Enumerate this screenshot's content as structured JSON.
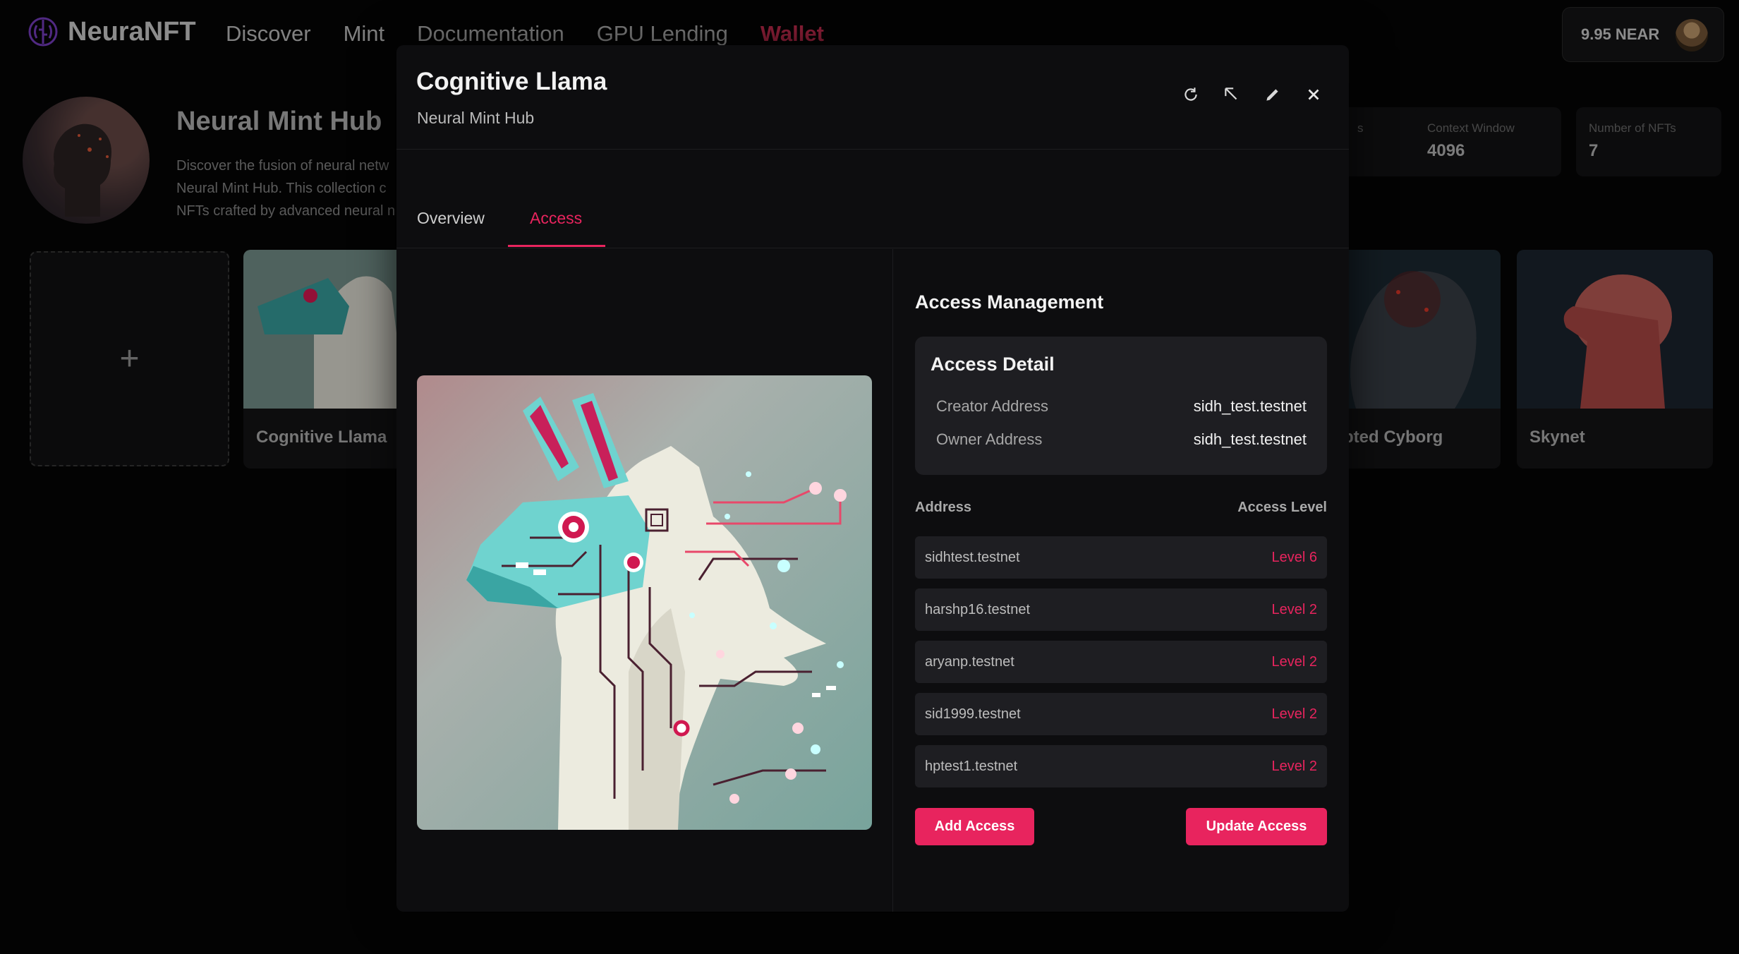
{
  "nav": {
    "brand": "NeuraNFT",
    "links": [
      "Discover",
      "Mint",
      "Documentation",
      "GPU Lending",
      "Wallet"
    ],
    "active": "Wallet",
    "wallet_balance": "9.95 NEAR"
  },
  "collection": {
    "title": "Neural Mint Hub",
    "description_lines": [
      "Discover the fusion of neural netw",
      "Neural Mint Hub. This collection c",
      "NFTs crafted by advanced neural n"
    ],
    "stats": [
      {
        "label": "s",
        "value": ""
      },
      {
        "label": "Context Window",
        "value": "4096"
      },
      {
        "label": "Number of NFTs",
        "value": "7"
      }
    ],
    "mint_card_symbol": "+",
    "nfts": [
      {
        "name": "Cognitive Llama"
      },
      {
        "name": "rupted Cyborg"
      },
      {
        "name": "Skynet"
      }
    ]
  },
  "modal": {
    "title": "Cognitive Llama",
    "subtitle": "Neural Mint Hub",
    "actions": [
      "refresh-icon",
      "expand-icon",
      "edit-icon",
      "close-icon"
    ],
    "tabs": [
      "Overview",
      "Access"
    ],
    "active_tab": "Access",
    "access": {
      "heading": "Access Management",
      "detail": {
        "title": "Access Detail",
        "creator_label": "Creator Address",
        "creator_value": "sidh_test.testnet",
        "owner_label": "Owner Address",
        "owner_value": "sidh_test.testnet"
      },
      "columns": {
        "address": "Address",
        "level": "Access Level"
      },
      "rows": [
        {
          "address": "sidhtest.testnet",
          "level": "Level 6"
        },
        {
          "address": "harshp16.testnet",
          "level": "Level 2"
        },
        {
          "address": "aryanp.testnet",
          "level": "Level 2"
        },
        {
          "address": "sid1999.testnet",
          "level": "Level 2"
        },
        {
          "address": "hptest1.testnet",
          "level": "Level 2"
        }
      ],
      "add_button": "Add Access",
      "update_button": "Update Access"
    }
  },
  "colors": {
    "accent": "#e8245e",
    "background": "#050505",
    "modal": "#0d0d0f",
    "card": "#1e1e22"
  }
}
